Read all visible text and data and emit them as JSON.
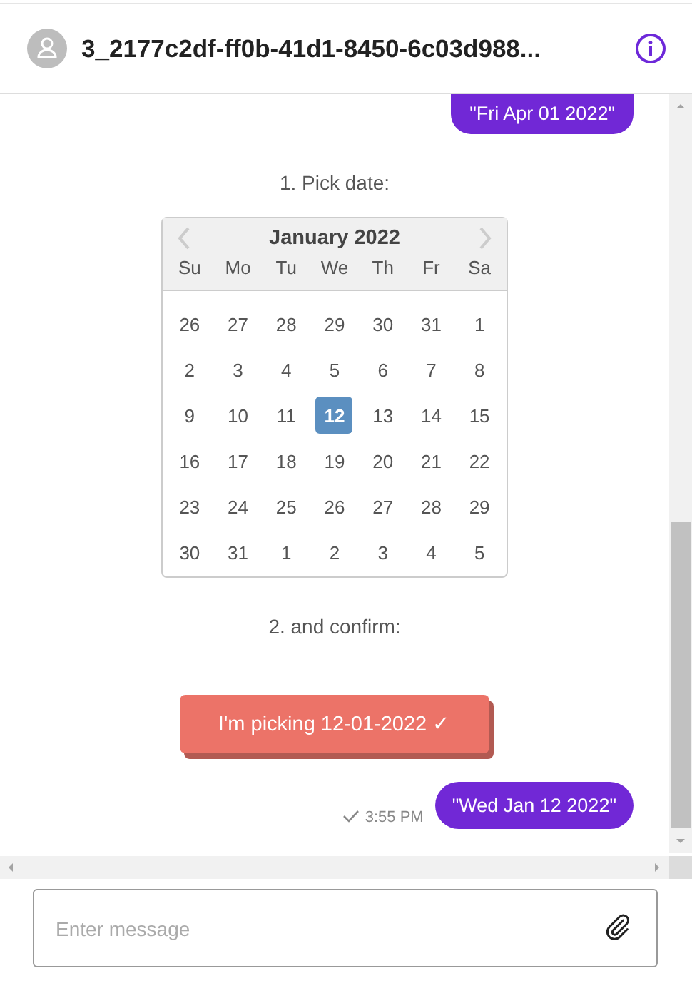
{
  "header": {
    "title": "3_2177c2df-ff0b-41d1-8450-6c03d988..."
  },
  "messages": [
    {
      "kind": "outgoing",
      "text": "\"Fri Apr 01 2022\""
    },
    {
      "kind": "prompt",
      "text": "1. Pick date:"
    },
    {
      "kind": "calendar",
      "month": "January 2022",
      "weekdays": [
        "Su",
        "Mo",
        "Tu",
        "We",
        "Th",
        "Fr",
        "Sa"
      ],
      "weeks": [
        [
          {
            "label": "26",
            "selected": false
          },
          {
            "label": "27",
            "selected": false
          },
          {
            "label": "28",
            "selected": false
          },
          {
            "label": "29",
            "selected": false
          },
          {
            "label": "30",
            "selected": false
          },
          {
            "label": "31",
            "selected": false
          },
          {
            "label": "1",
            "selected": false
          }
        ],
        [
          {
            "label": "2",
            "selected": false
          },
          {
            "label": "3",
            "selected": false
          },
          {
            "label": "4",
            "selected": false
          },
          {
            "label": "5",
            "selected": false
          },
          {
            "label": "6",
            "selected": false
          },
          {
            "label": "7",
            "selected": false
          },
          {
            "label": "8",
            "selected": false
          }
        ],
        [
          {
            "label": "9",
            "selected": false
          },
          {
            "label": "10",
            "selected": false
          },
          {
            "label": "11",
            "selected": false
          },
          {
            "label": "12",
            "selected": true
          },
          {
            "label": "13",
            "selected": false
          },
          {
            "label": "14",
            "selected": false
          },
          {
            "label": "15",
            "selected": false
          }
        ],
        [
          {
            "label": "16",
            "selected": false
          },
          {
            "label": "17",
            "selected": false
          },
          {
            "label": "18",
            "selected": false
          },
          {
            "label": "19",
            "selected": false
          },
          {
            "label": "20",
            "selected": false
          },
          {
            "label": "21",
            "selected": false
          },
          {
            "label": "22",
            "selected": false
          }
        ],
        [
          {
            "label": "23",
            "selected": false
          },
          {
            "label": "24",
            "selected": false
          },
          {
            "label": "25",
            "selected": false
          },
          {
            "label": "26",
            "selected": false
          },
          {
            "label": "27",
            "selected": false
          },
          {
            "label": "28",
            "selected": false
          },
          {
            "label": "29",
            "selected": false
          }
        ],
        [
          {
            "label": "30",
            "selected": false
          },
          {
            "label": "31",
            "selected": false
          },
          {
            "label": "1",
            "selected": false
          },
          {
            "label": "2",
            "selected": false
          },
          {
            "label": "3",
            "selected": false
          },
          {
            "label": "4",
            "selected": false
          },
          {
            "label": "5",
            "selected": false
          }
        ]
      ]
    },
    {
      "kind": "prompt",
      "text": "2. and confirm:"
    },
    {
      "kind": "action",
      "text": "I'm picking 12-01-2022 ✓"
    },
    {
      "kind": "outgoing",
      "text": "\"Wed Jan 12 2022\"",
      "time": "3:55 PM"
    }
  ],
  "composer": {
    "placeholder": "Enter message"
  }
}
